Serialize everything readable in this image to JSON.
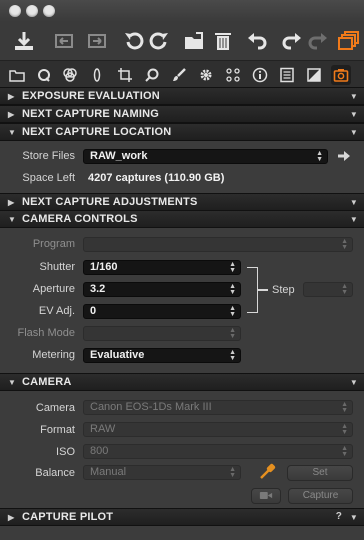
{
  "window": {
    "traffic_lights": [
      "close",
      "minimize",
      "zoom"
    ]
  },
  "toolbar": {
    "icons": [
      "import-icon",
      "back-icon",
      "forward-icon",
      "rotate-left-icon",
      "rotate-right-icon",
      "folder-move-icon",
      "trash-icon",
      "undo-icon",
      "redo-icon",
      "redo-disabled-icon",
      "stack-icon"
    ]
  },
  "tabs": [
    "folder-icon",
    "search-icon",
    "color-icon",
    "lens-icon",
    "crop-icon",
    "magnifier-icon",
    "brush-icon",
    "gear-icon",
    "keyword-icon",
    "info-icon",
    "list-icon",
    "bw-icon",
    "camera-icon"
  ],
  "sections": {
    "exposure_evaluation": "EXPOSURE EVALUATION",
    "next_capture_naming": "NEXT CAPTURE NAMING",
    "next_capture_location": "NEXT CAPTURE LOCATION",
    "next_capture_adjustments": "NEXT CAPTURE ADJUSTMENTS",
    "camera_controls": "CAMERA CONTROLS",
    "camera": "CAMERA",
    "capture_pilot": "CAPTURE PILOT"
  },
  "location": {
    "store_files_label": "Store Files",
    "store_files_value": "RAW_work",
    "space_left_label": "Space Left",
    "space_left_value": "4207 captures (110.90 GB)"
  },
  "camera_controls": {
    "program_label": "Program",
    "program_value": "",
    "shutter_label": "Shutter",
    "shutter_value": "1/160",
    "aperture_label": "Aperture",
    "aperture_value": "3.2",
    "ev_label": "EV Adj.",
    "ev_value": "0",
    "step_label": "Step",
    "step_value": "",
    "flash_label": "Flash Mode",
    "flash_value": "",
    "metering_label": "Metering",
    "metering_value": "Evaluative"
  },
  "camera": {
    "camera_label": "Camera",
    "camera_value": "Canon EOS-1Ds Mark III",
    "format_label": "Format",
    "format_value": "RAW",
    "iso_label": "ISO",
    "iso_value": "800",
    "balance_label": "Balance",
    "balance_value": "Manual",
    "set_button": "Set",
    "capture_button": "Capture"
  },
  "capture_pilot": {
    "help": "?"
  }
}
